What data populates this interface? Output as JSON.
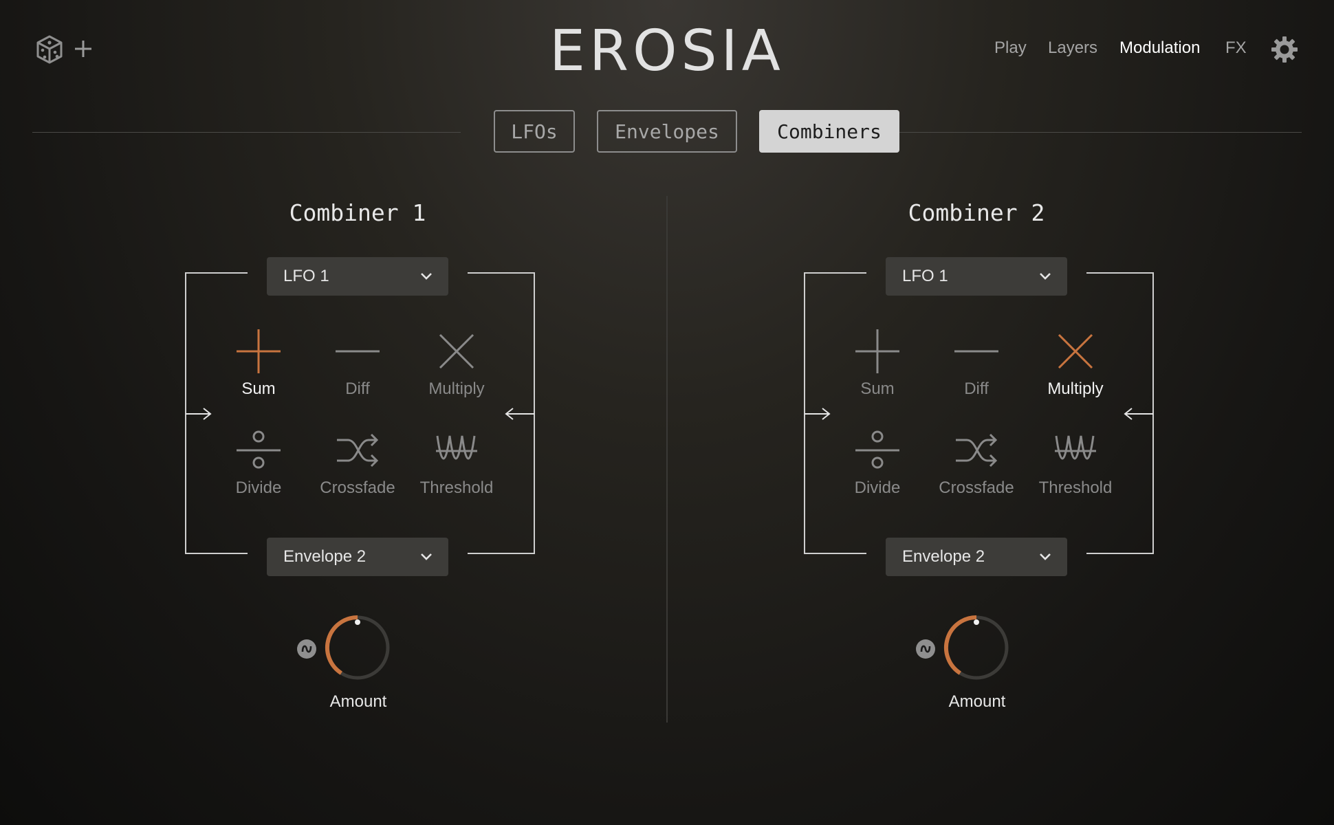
{
  "app": {
    "title": "EROSIA"
  },
  "header": {
    "nav": [
      {
        "label": "Play",
        "active": false
      },
      {
        "label": "Layers",
        "active": false
      },
      {
        "label": "Modulation",
        "active": true
      },
      {
        "label": "FX",
        "active": false
      }
    ],
    "icons": [
      "dice-icon",
      "plus-icon",
      "gear-icon"
    ]
  },
  "tabs": [
    {
      "label": "LFOs",
      "active": false
    },
    {
      "label": "Envelopes",
      "active": false
    },
    {
      "label": "Combiners",
      "active": true
    }
  ],
  "combiners": [
    {
      "title": "Combiner 1",
      "source_a": "LFO 1",
      "source_b": "Envelope 2",
      "selected_operation": "Sum",
      "operations": [
        "Sum",
        "Diff",
        "Multiply",
        "Divide",
        "Crossfade",
        "Threshold"
      ],
      "amount_label": "Amount",
      "amount_value": 0.5
    },
    {
      "title": "Combiner 2",
      "source_a": "LFO 1",
      "source_b": "Envelope 2",
      "selected_operation": "Multiply",
      "operations": [
        "Sum",
        "Diff",
        "Multiply",
        "Divide",
        "Crossfade",
        "Threshold"
      ],
      "amount_label": "Amount",
      "amount_value": 0.5
    }
  ],
  "colors": {
    "accent": "#c8743f",
    "text": "#e8e8e8",
    "muted": "#8a8a8a",
    "dropdown_bg": "#3d3c39",
    "tab_active_bg": "#d4d4d4"
  }
}
